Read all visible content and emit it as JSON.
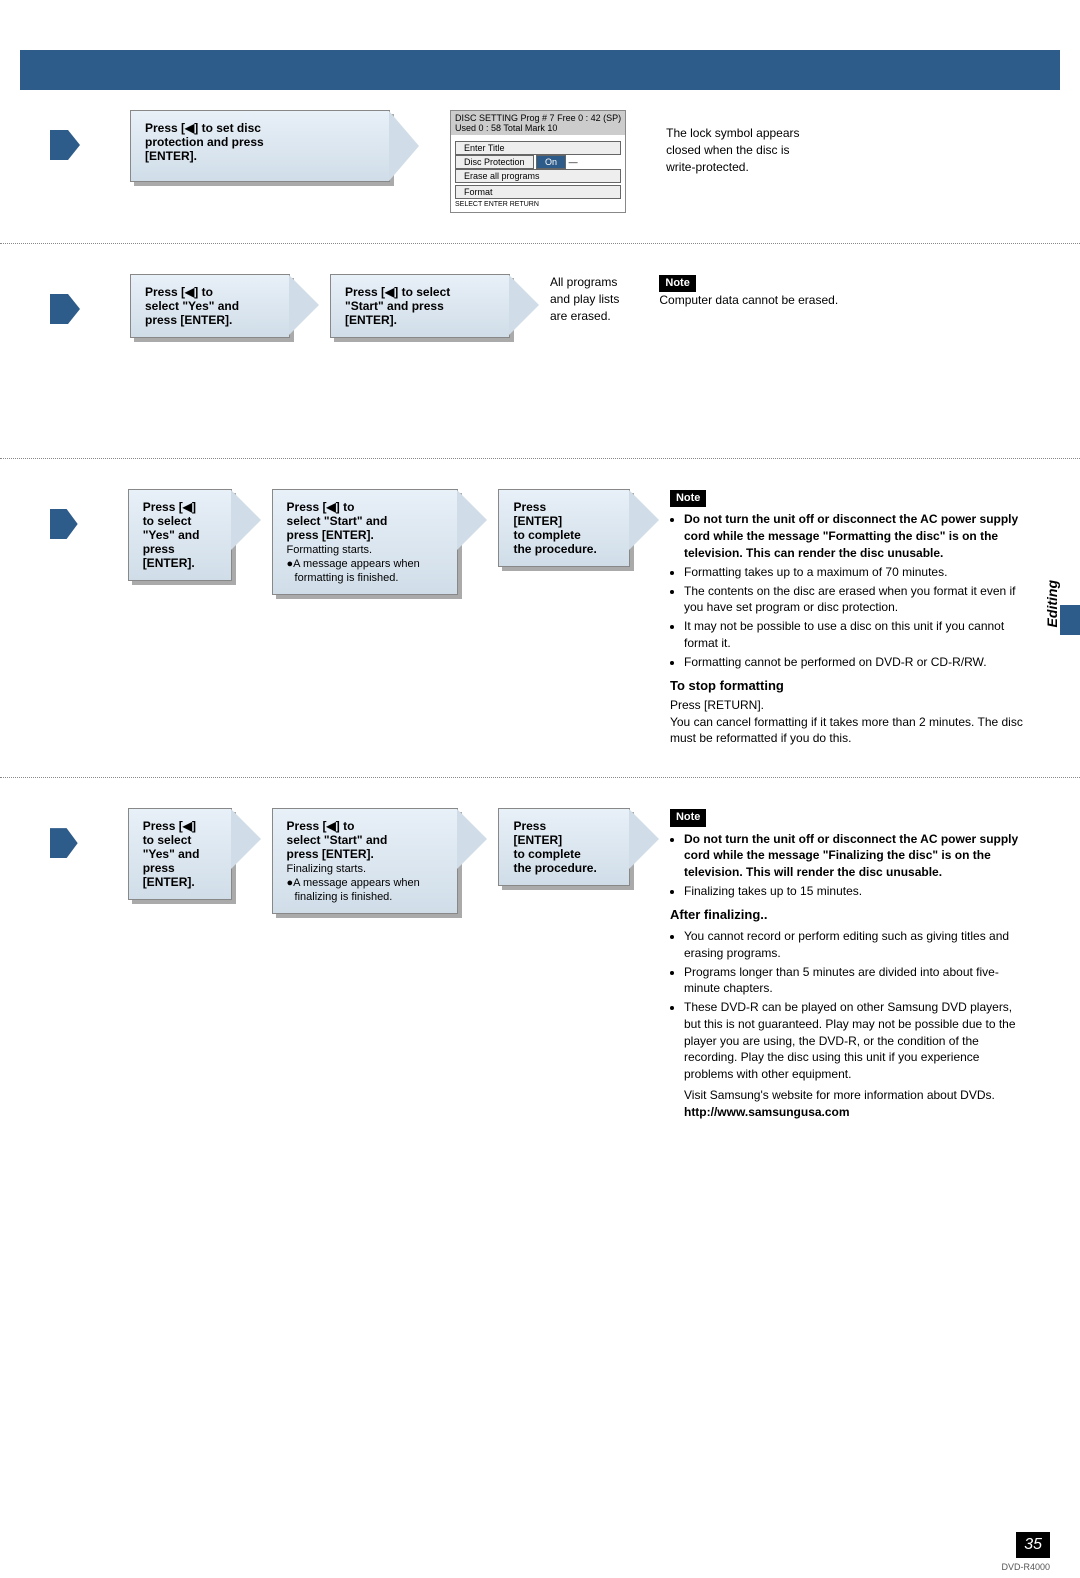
{
  "header": {
    "title": ""
  },
  "section1": {
    "box1": {
      "l1": "Press [◀] to set disc",
      "l2": "protection and press",
      "l3": "[ENTER]."
    },
    "diagram": {
      "top_label": "DISC SETTING",
      "prog": "Prog # 7",
      "used": "Used 0 : 58",
      "free": "Free 0 : 42 (SP)",
      "mark": "Total Mark 10",
      "btn1": "Enter Title",
      "btn2": "Disc Protection",
      "btn2_state": "On",
      "btn3": "Erase all programs",
      "btn4": "Format",
      "ctrl": "SELECT ENTER RETURN"
    },
    "right": {
      "l1": "The lock symbol appears",
      "l2": "closed when the disc is",
      "l3": "write-protected."
    }
  },
  "section2": {
    "box1": {
      "l1": "Press [◀] to",
      "l2": "select \"Yes\" and",
      "l3": "press [ENTER]."
    },
    "box2": {
      "l1": "Press [◀] to select",
      "l2": "\"Start\" and press",
      "l3": "[ENTER]."
    },
    "mid": {
      "l1": "All programs",
      "l2": "and play lists",
      "l3": "are erased."
    },
    "note": "Note",
    "note_text": "Computer data cannot be erased."
  },
  "sidebar": "Editing",
  "section3": {
    "box1": {
      "l1": "Press [◀]",
      "l2": "to select",
      "l3": "\"Yes\" and",
      "l4": "press",
      "l5": "[ENTER]."
    },
    "box2": {
      "l1": "Press [◀] to",
      "l2": "select \"Start\" and",
      "l3": "press [ENTER].",
      "l4": "Formatting starts.",
      "l5": "●A message appears when",
      "l6": "formatting is finished."
    },
    "box3": {
      "l1": "Press",
      "l2": "[ENTER]",
      "l3": "to complete",
      "l4": "the procedure."
    },
    "note": "Note",
    "bullets": {
      "b1": "Do not turn the unit off or disconnect the AC power supply cord while the message \"Formatting the disc\" is on the television. This can render the disc unusable.",
      "b2": "Formatting takes up to a maximum of 70 minutes.",
      "b3": "The contents on the disc are erased when you format it even if you have set program or disc protection.",
      "b4": "It may not be possible to use a disc on this unit if you cannot format it.",
      "b5": "Formatting cannot be performed on DVD-R or CD-R/RW."
    },
    "stop_h": "To stop formatting",
    "stop_l1": "Press [RETURN].",
    "stop_l2": "You can cancel formatting if it takes more than 2 minutes. The disc must be reformatted if you do this."
  },
  "section4": {
    "box1": {
      "l1": "Press [◀]",
      "l2": "to select",
      "l3": "\"Yes\" and",
      "l4": "press",
      "l5": "[ENTER]."
    },
    "box2": {
      "l1": "Press [◀] to",
      "l2": "select \"Start\" and",
      "l3": "press [ENTER].",
      "l4": "Finalizing starts.",
      "l5": "●A message appears when",
      "l6": "finalizing is finished."
    },
    "box3": {
      "l1": "Press",
      "l2": "[ENTER]",
      "l3": "to complete",
      "l4": "the procedure."
    },
    "note": "Note",
    "bullets": {
      "b1": "Do not turn the unit off or disconnect the AC power supply cord while the message \"Finalizing the disc\" is on the television. This will render the disc unusable.",
      "b2": "Finalizing takes up to 15 minutes."
    },
    "after_h": "After finalizing..",
    "after": {
      "a1": "You cannot record or perform editing such as giving titles and erasing programs.",
      "a2": "Programs longer than 5 minutes are divided into about five-minute chapters.",
      "a3": "These DVD-R can be played on other Samsung DVD players, but this is not guaranteed. Play may not be possible due to the player you are using, the DVD-R, or the condition of the recording. Play the disc using this unit if you experience problems with other equipment.",
      "a4": "Visit Samsung's website for more information about DVDs."
    },
    "url": "http://www.samsungusa.com"
  },
  "page_num": "35",
  "model": "DVD-R4000"
}
